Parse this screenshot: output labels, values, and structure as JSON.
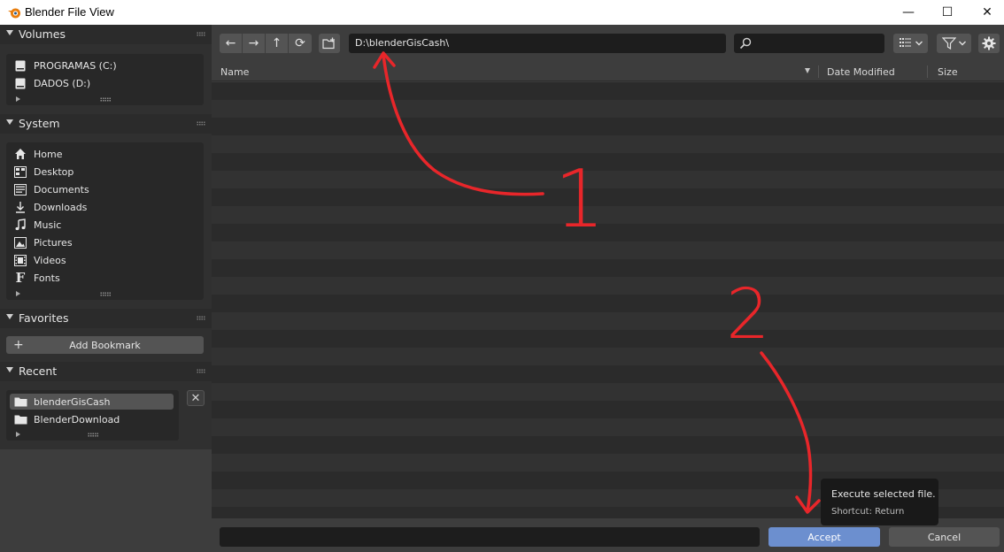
{
  "window": {
    "title": "Blender File View",
    "controls": {
      "minimize": "—",
      "maximize": "☐",
      "close": "✕"
    }
  },
  "sidebar": {
    "volumes": {
      "header": "Volumes",
      "items": [
        {
          "label": "PROGRAMAS (C:)",
          "icon": "drive-icon"
        },
        {
          "label": "DADOS (D:)",
          "icon": "drive-icon"
        }
      ]
    },
    "system": {
      "header": "System",
      "items": [
        {
          "label": "Home",
          "icon": "home-icon"
        },
        {
          "label": "Desktop",
          "icon": "desktop-icon"
        },
        {
          "label": "Documents",
          "icon": "documents-icon"
        },
        {
          "label": "Downloads",
          "icon": "download-icon"
        },
        {
          "label": "Music",
          "icon": "music-icon"
        },
        {
          "label": "Pictures",
          "icon": "pictures-icon"
        },
        {
          "label": "Videos",
          "icon": "videos-icon"
        },
        {
          "label": "Fonts",
          "icon": "fonts-icon"
        }
      ]
    },
    "favorites": {
      "header": "Favorites",
      "add_bookmark": "Add Bookmark",
      "plus": "+"
    },
    "recent": {
      "header": "Recent",
      "items": [
        {
          "label": "blenderGisCash",
          "icon": "folder-icon",
          "selected": true
        },
        {
          "label": "BlenderDownload",
          "icon": "folder-icon",
          "selected": false
        }
      ],
      "remove": "✕"
    }
  },
  "toolbar": {
    "nav": {
      "back": "←",
      "forward": "→",
      "parent": "↑",
      "refresh": "⟳"
    },
    "path": "D:\\blenderGisCash\\",
    "search_value": ""
  },
  "columns": {
    "name": "Name",
    "date": "Date Modified",
    "size": "Size"
  },
  "footer": {
    "filename_value": "",
    "accept": "Accept",
    "cancel": "Cancel"
  },
  "tooltip": {
    "line1": "Execute selected file.",
    "line2": "Shortcut: Return"
  },
  "annotations": {
    "label_1": "1",
    "label_2": "2",
    "color": "#e8262a"
  },
  "colors": {
    "accent": "#6c8fcf",
    "panel": "#3d3d3d",
    "sidebar": "#303030",
    "field": "#1d1d1d"
  }
}
